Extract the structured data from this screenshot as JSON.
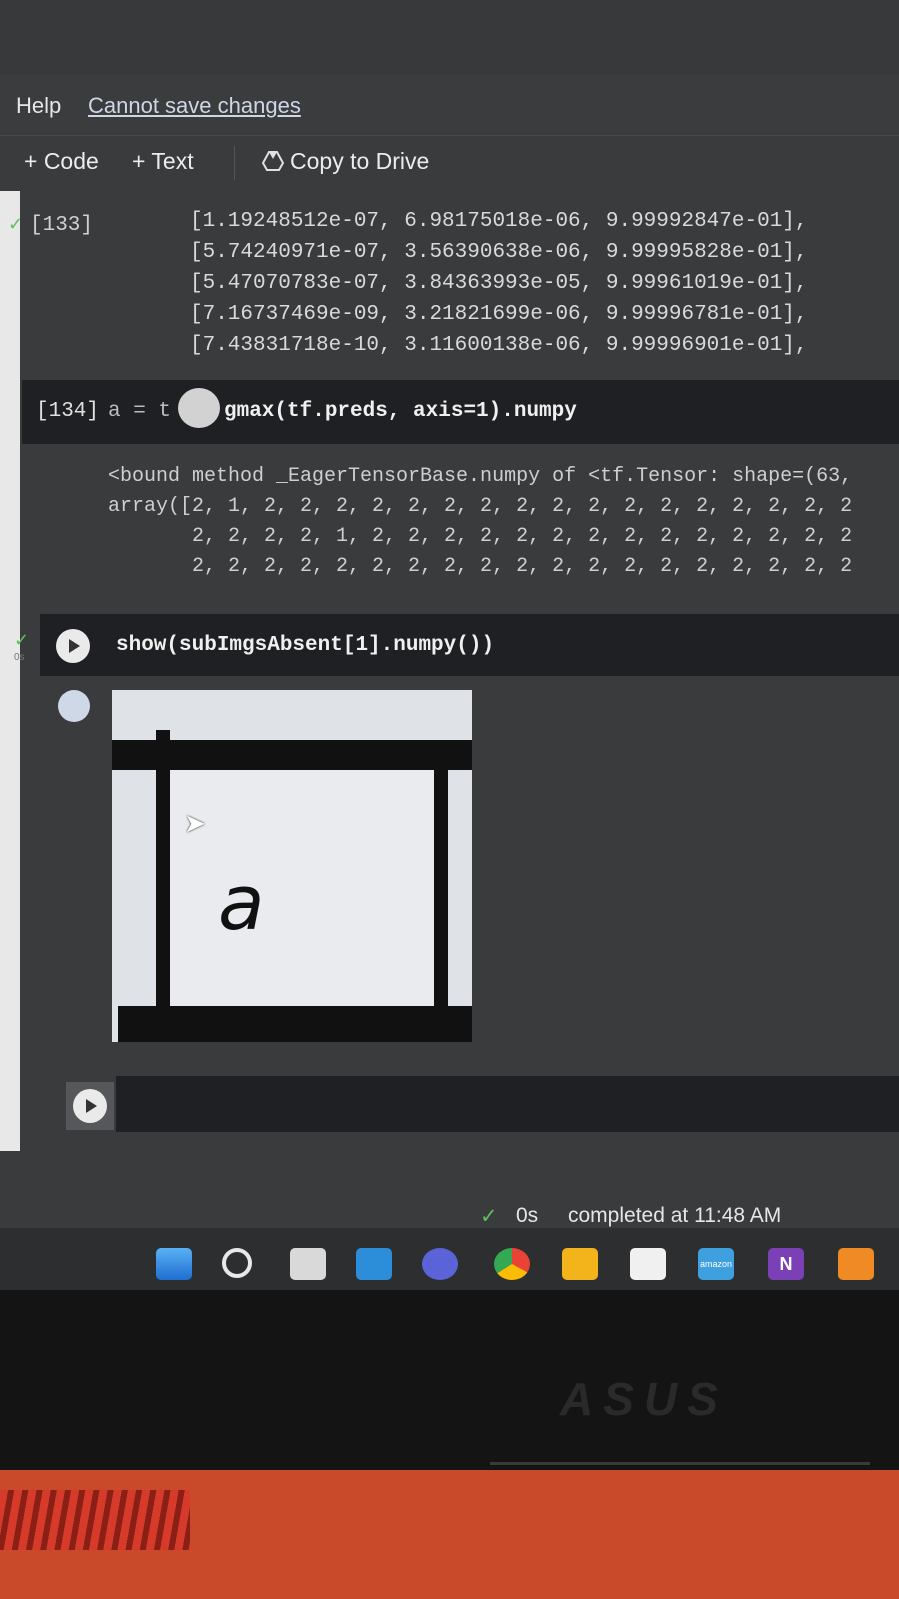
{
  "menu": {
    "help": "Help",
    "save_notice": "Cannot save changes"
  },
  "toolbar": {
    "code": "+ Code",
    "text": "+ Text",
    "copy_to_drive": "Copy to Drive"
  },
  "cell133": {
    "prompt": "[133]",
    "lines": [
      "[1.19248512e-07, 6.98175018e-06, 9.99992847e-01],",
      "[5.74240971e-07, 3.56390638e-06, 9.99995828e-01],",
      "[5.47070783e-07, 3.84363993e-05, 9.99961019e-01],",
      "[7.16737469e-09, 3.21821699e-06, 9.99996781e-01],",
      "[7.43831718e-10, 3.11600138e-06, 9.99996901e-01],"
    ]
  },
  "cell134": {
    "prompt": "[134]",
    "code_a": "a = t",
    "code_b": "gmax(tf.preds, axis=1).numpy",
    "output": [
      "<bound method _EagerTensorBase.numpy of <tf.Tensor: shape=(63,",
      "array([2, 1, 2, 2, 2, 2, 2, 2, 2, 2, 2, 2, 2, 2, 2, 2, 2, 2, 2",
      "       2, 2, 2, 2, 1, 2, 2, 2, 2, 2, 2, 2, 2, 2, 2, 2, 2, 2, 2",
      "       2, 2, 2, 2, 2, 2, 2, 2, 2, 2, 2, 2, 2, 2, 2, 2, 2, 2, 2"
    ]
  },
  "cell135": {
    "code": "show(subImgsAbsent[1].numpy())",
    "time": "0s",
    "image_letter": "a"
  },
  "status": {
    "time": "0s",
    "message": "completed at 11:48 AM"
  },
  "taskbar": [
    "windows-start",
    "search",
    "task-view",
    "widgets",
    "teams",
    "chrome",
    "file-explorer",
    "microsoft-store",
    "amazon-music",
    "onenote",
    "sublime"
  ],
  "taskbar_labels": {
    "amazon": "amazon music",
    "onenote": "N"
  },
  "brand": "ASUS",
  "colors": {
    "code_bg": "#1f2023",
    "screen_bg": "#3a3b3d",
    "keyboard": "#c84a2a"
  }
}
